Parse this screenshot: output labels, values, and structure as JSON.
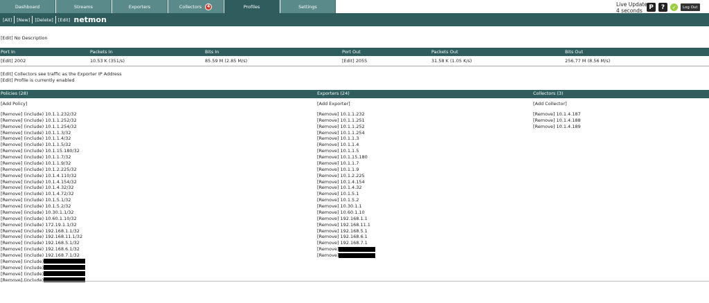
{
  "nav": {
    "tabs": [
      {
        "label": "Dashboard"
      },
      {
        "label": "Streams"
      },
      {
        "label": "Exporters"
      },
      {
        "label": "Collectors",
        "badge": "4"
      },
      {
        "label": "Profiles"
      },
      {
        "label": "Settings"
      }
    ],
    "live_update_label": "Live Update",
    "live_update_value": "4 seconds",
    "logout_label": "Log Out",
    "help_glyph": "?",
    "pause_glyph": "P",
    "check_glyph": "✓"
  },
  "header": {
    "links": [
      "[All]",
      "[New]",
      "[Delete]",
      "[Edit]"
    ],
    "profile_name": "netmon"
  },
  "description": "[Edit] No Description",
  "stats": {
    "headers": [
      "Port In",
      "Packets In",
      "Bits In",
      "Port Out",
      "Packets Out",
      "Bits Out"
    ],
    "values": [
      "[Edit]  2002",
      "10.53 K (351/s)",
      "85.59 M (2.85 M/s)",
      "[Edit]  2055",
      "31.58 K (1.05 K/s)",
      "256.77 M (8.56 M/s)"
    ]
  },
  "notes": [
    "[Edit]  Collectors see traffic as the Exporter IP Address",
    "[Edit]  Profile is currently enabled"
  ],
  "policies": {
    "title": "Policies (28)",
    "add_label": "[Add Policy]",
    "items": [
      "[Remove]  (include)  10.1.1.232/32",
      "[Remove]  (include)  10.1.1.252/32",
      "[Remove]  (include)  10.1.1.254/32",
      "[Remove]  (include)  10.1.1.3/32",
      "[Remove]  (include)  10.1.1.4/32",
      "[Remove]  (include)  10.1.1.5/32",
      "[Remove]  (include)  10.1.15.180/32",
      "[Remove]  (include)  10.1.1.7/32",
      "[Remove]  (include)  10.1.1.9/32",
      "[Remove]  (include)  10.1.2.225/32",
      "[Remove]  (include)  10.1.4.110/32",
      "[Remove]  (include)  10.1.4.154/32",
      "[Remove]  (include)  10.1.4.32/32",
      "[Remove]  (include)  10.1.4.72/32",
      "[Remove]  (include)  10.1.5.1/32",
      "[Remove]  (include)  10.1.5.2/32",
      "[Remove]  (include)  10.30.1.1/32",
      "[Remove]  (include)  10.60.1.10/32",
      "[Remove]  (include)  172.19.1.1/32",
      "[Remove]  (include)  192.168.1.1/32",
      "[Remove]  (include)  192.168.11.1/32",
      "[Remove]  (include)  192.168.5.1/32",
      "[Remove]  (include)  192.168.6.1/32",
      "[Remove]  (include)  192.168.7.1/32"
    ],
    "redacted_prefix": "[Remove]  (include)",
    "redacted_count": 4
  },
  "exporters": {
    "title": "Exporters (24)",
    "add_label": "[Add Exporter]",
    "items": [
      "[Remove]  10.1.1.232",
      "[Remove]  10.1.1.251",
      "[Remove]  10.1.1.252",
      "[Remove]  10.1.1.254",
      "[Remove]  10.1.1.3",
      "[Remove]  10.1.1.4",
      "[Remove]  10.1.1.5",
      "[Remove]  10.1.15.180",
      "[Remove]  10.1.1.7",
      "[Remove]  10.1.1.9",
      "[Remove]  10.1.2.225",
      "[Remove]  10.1.4.154",
      "[Remove]  10.1.4.32",
      "[Remove]  10.1.5.1",
      "[Remove]  10.1.5.2",
      "[Remove]  10.30.1.1",
      "[Remove]  10.60.1.10",
      "[Remove]  192.168.1.1",
      "[Remove]  192.168.11.1",
      "[Remove]  192.168.5.1",
      "[Remove]  192.168.6.1",
      "[Remove]  192.168.7.1"
    ],
    "redacted_prefix": "[Remove]",
    "redacted_count": 2
  },
  "collectors": {
    "title": "Collectors (3)",
    "add_label": "[Add Collector]",
    "items": [
      "[Remove]  10.1.4.187",
      "[Remove]  10.1.4.188",
      "[Remove]  10.1.4.189"
    ]
  },
  "colors": {
    "header_bg": "#2f5d5d",
    "tab_bg": "#5b8a8a",
    "badge_red": "#d23a2e",
    "ok_green": "#9ccf3f"
  }
}
